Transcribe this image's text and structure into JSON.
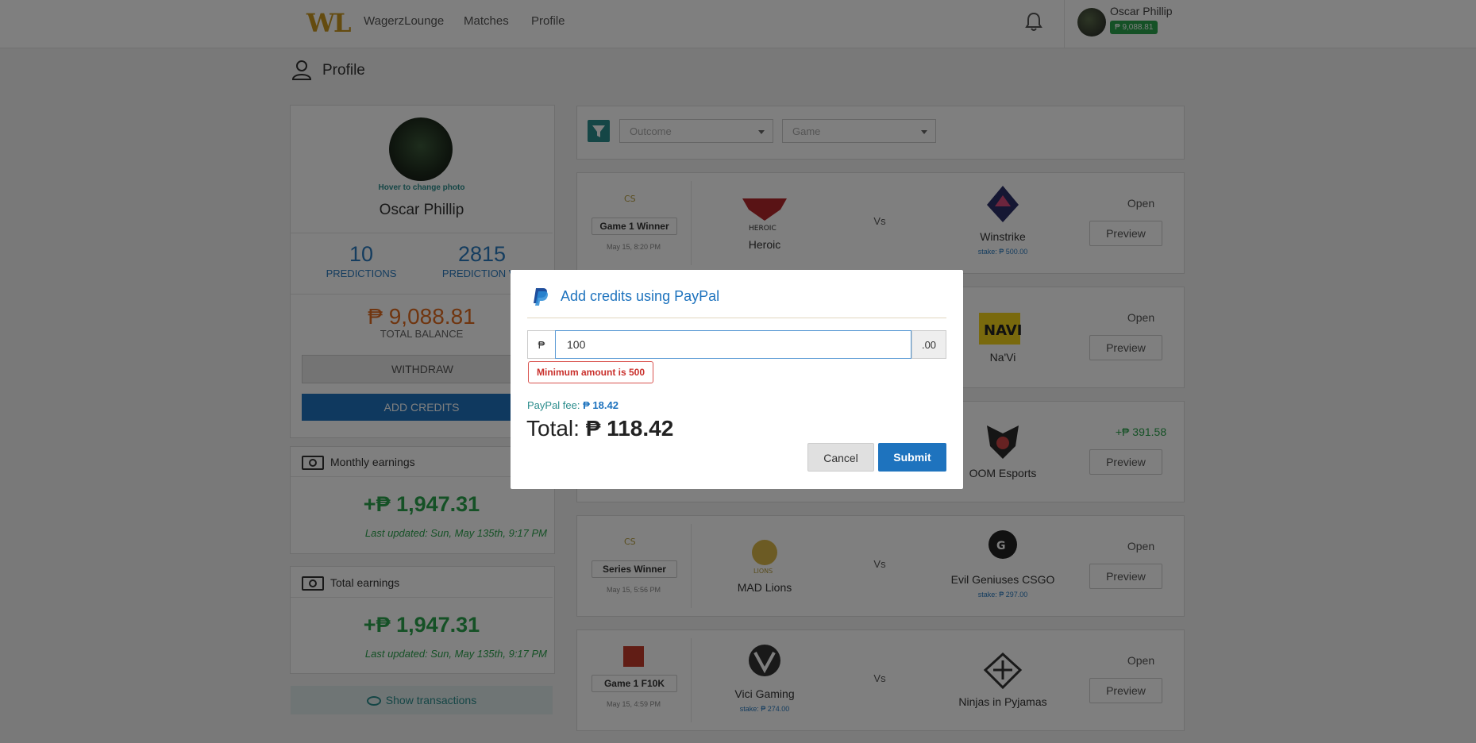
{
  "nav": {
    "logo": "WL",
    "brand": "WagerzLounge",
    "links": [
      "Matches",
      "Profile"
    ],
    "user_name": "Oscar Phillip",
    "user_balance": "₱ 9,088.81"
  },
  "page": {
    "title": "Profile"
  },
  "profile": {
    "hover_note": "Hover to change photo",
    "name": "Oscar Phillip",
    "predictions_count": "10",
    "predictions_label": "PREDICTIONS",
    "prediction_value": "2815",
    "prediction_value_label": "PREDICTION VA",
    "balance": "₱ 9,088.81",
    "balance_label": "TOTAL BALANCE",
    "withdraw_label": "WITHDRAW",
    "add_credits_label": "ADD CREDITS"
  },
  "earnings": {
    "monthly_title": "Monthly earnings",
    "monthly_value": "+₱ 1,947.31",
    "monthly_updated": "Last updated: Sun, May 135th, 9:17 PM",
    "total_title": "Total earnings",
    "total_value": "+₱ 1,947.31",
    "total_updated": "Last updated: Sun, May 135th, 9:17 PM",
    "show_transactions": "Show transactions"
  },
  "filters": {
    "outcome_placeholder": "Outcome",
    "game_placeholder": "Game"
  },
  "matches": [
    {
      "badge": "Game 1 Winner",
      "date": "May 15, 8:20 PM",
      "team1": "Heroic",
      "team1_stake": "",
      "vs": "Vs",
      "team2": "Winstrike",
      "team2_stake": "stake: ₱ 500.00",
      "status": "Open",
      "action": "Preview"
    },
    {
      "badge": "",
      "date": "",
      "team1": "",
      "team1_stake": "",
      "vs": "",
      "team2": "Na'Vi",
      "team2_stake": "",
      "status": "Open",
      "action": "Preview"
    },
    {
      "badge": "",
      "date": "",
      "team1": "",
      "team1_stake": "",
      "vs": "",
      "team2": "OOM Esports",
      "team2_stake": "",
      "status": "+₱ 391.58",
      "action": "Preview"
    },
    {
      "badge": "Series Winner",
      "date": "May 15, 5:56 PM",
      "team1": "MAD Lions",
      "team1_stake": "",
      "vs": "Vs",
      "team2": "Evil Geniuses CSGO",
      "team2_stake": "stake: ₱ 297.00",
      "status": "Open",
      "action": "Preview"
    },
    {
      "badge": "Game 1 F10K",
      "date": "May 15, 4:59 PM",
      "team1": "Vici Gaming",
      "team1_stake": "stake: ₱ 274.00",
      "vs": "Vs",
      "team2": "Ninjas in Pyjamas",
      "team2_stake": "",
      "status": "Open",
      "action": "Preview"
    }
  ],
  "modal": {
    "title": "Add credits using PayPal",
    "currency_symbol": "₱",
    "amount_value": "100",
    "cents_suffix": ".00",
    "error": "Minimum amount is 500",
    "fee_label": "PayPal fee:",
    "fee_value": "₱ 18.42",
    "total_label": "Total:",
    "total_value": "₱ 118.42",
    "cancel_label": "Cancel",
    "submit_label": "Submit"
  },
  "colors": {
    "accent_blue": "#1e73be",
    "teal": "#2a8c8c",
    "green": "#2ba24c",
    "orange": "#e06a1f",
    "error_red": "#c9302c"
  }
}
